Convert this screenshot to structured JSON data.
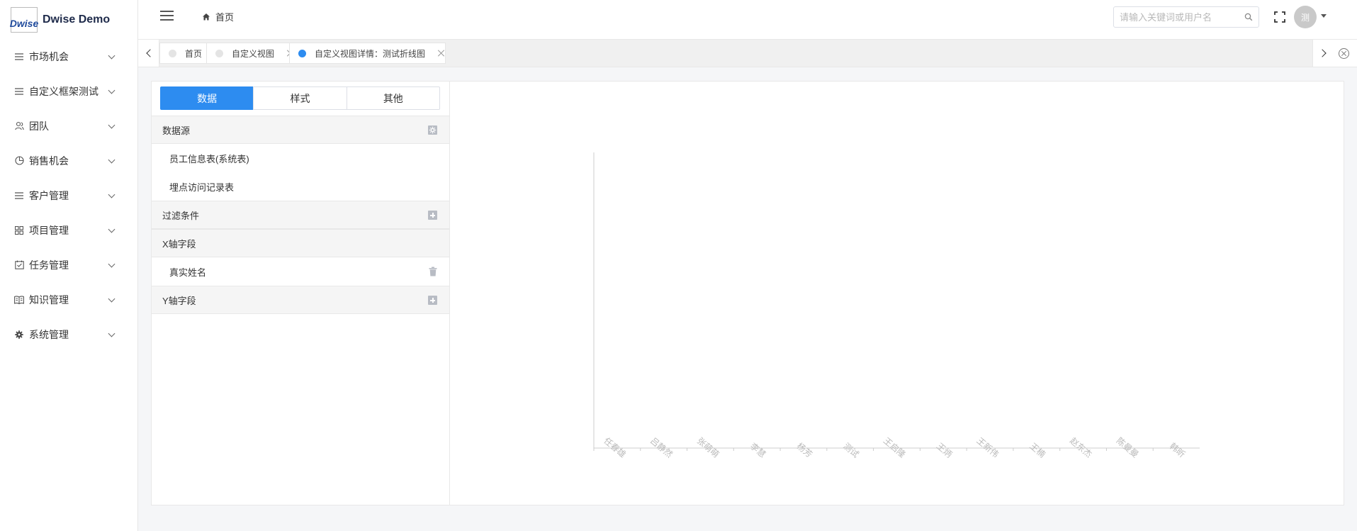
{
  "app": {
    "logo_text": "Dwise",
    "title": "Dwise Demo"
  },
  "sidebar": {
    "items": [
      {
        "label": "市场机会",
        "icon": "list-icon"
      },
      {
        "label": "自定义框架测试",
        "icon": "list-icon"
      },
      {
        "label": "团队",
        "icon": "team-icon"
      },
      {
        "label": "销售机会",
        "icon": "pie-icon"
      },
      {
        "label": "客户管理",
        "icon": "list-icon"
      },
      {
        "label": "项目管理",
        "icon": "grid-icon"
      },
      {
        "label": "任务管理",
        "icon": "task-icon"
      },
      {
        "label": "知识管理",
        "icon": "book-icon"
      },
      {
        "label": "系统管理",
        "icon": "gear-icon"
      }
    ]
  },
  "header": {
    "breadcrumb": "首页",
    "search_placeholder": "请输入关键词或用户名",
    "avatar_text": "测"
  },
  "tabs": [
    {
      "label": "首页",
      "active": false,
      "closable": false
    },
    {
      "label": "自定义视图",
      "active": false,
      "closable": true
    },
    {
      "label": "自定义视图详情：测试折线图",
      "active": true,
      "closable": true
    }
  ],
  "panel": {
    "segments": [
      "数据",
      "样式",
      "其他"
    ],
    "active_segment": "数据",
    "datasource_title": "数据源",
    "datasources": [
      "员工信息表(系统表)",
      "埋点访问记录表"
    ],
    "filter_title": "过滤条件",
    "x_title": "X轴字段",
    "x_fields": [
      "真实姓名"
    ],
    "y_title": "Y轴字段"
  },
  "colors": {
    "primary": "#2d8cf0",
    "axis": "#cccccc",
    "label": "#bbbbbb"
  },
  "chart_data": {
    "type": "line",
    "categories": [
      "任春雄",
      "吕静然",
      "张萌萌",
      "李慧",
      "杨芳",
      "测试",
      "王启隆",
      "王炳",
      "王新伟",
      "王楠",
      "赵东杰",
      "陈曼曼",
      "韩昕"
    ],
    "series": [],
    "title": "",
    "xlabel": "",
    "ylabel": "",
    "grid": false
  }
}
